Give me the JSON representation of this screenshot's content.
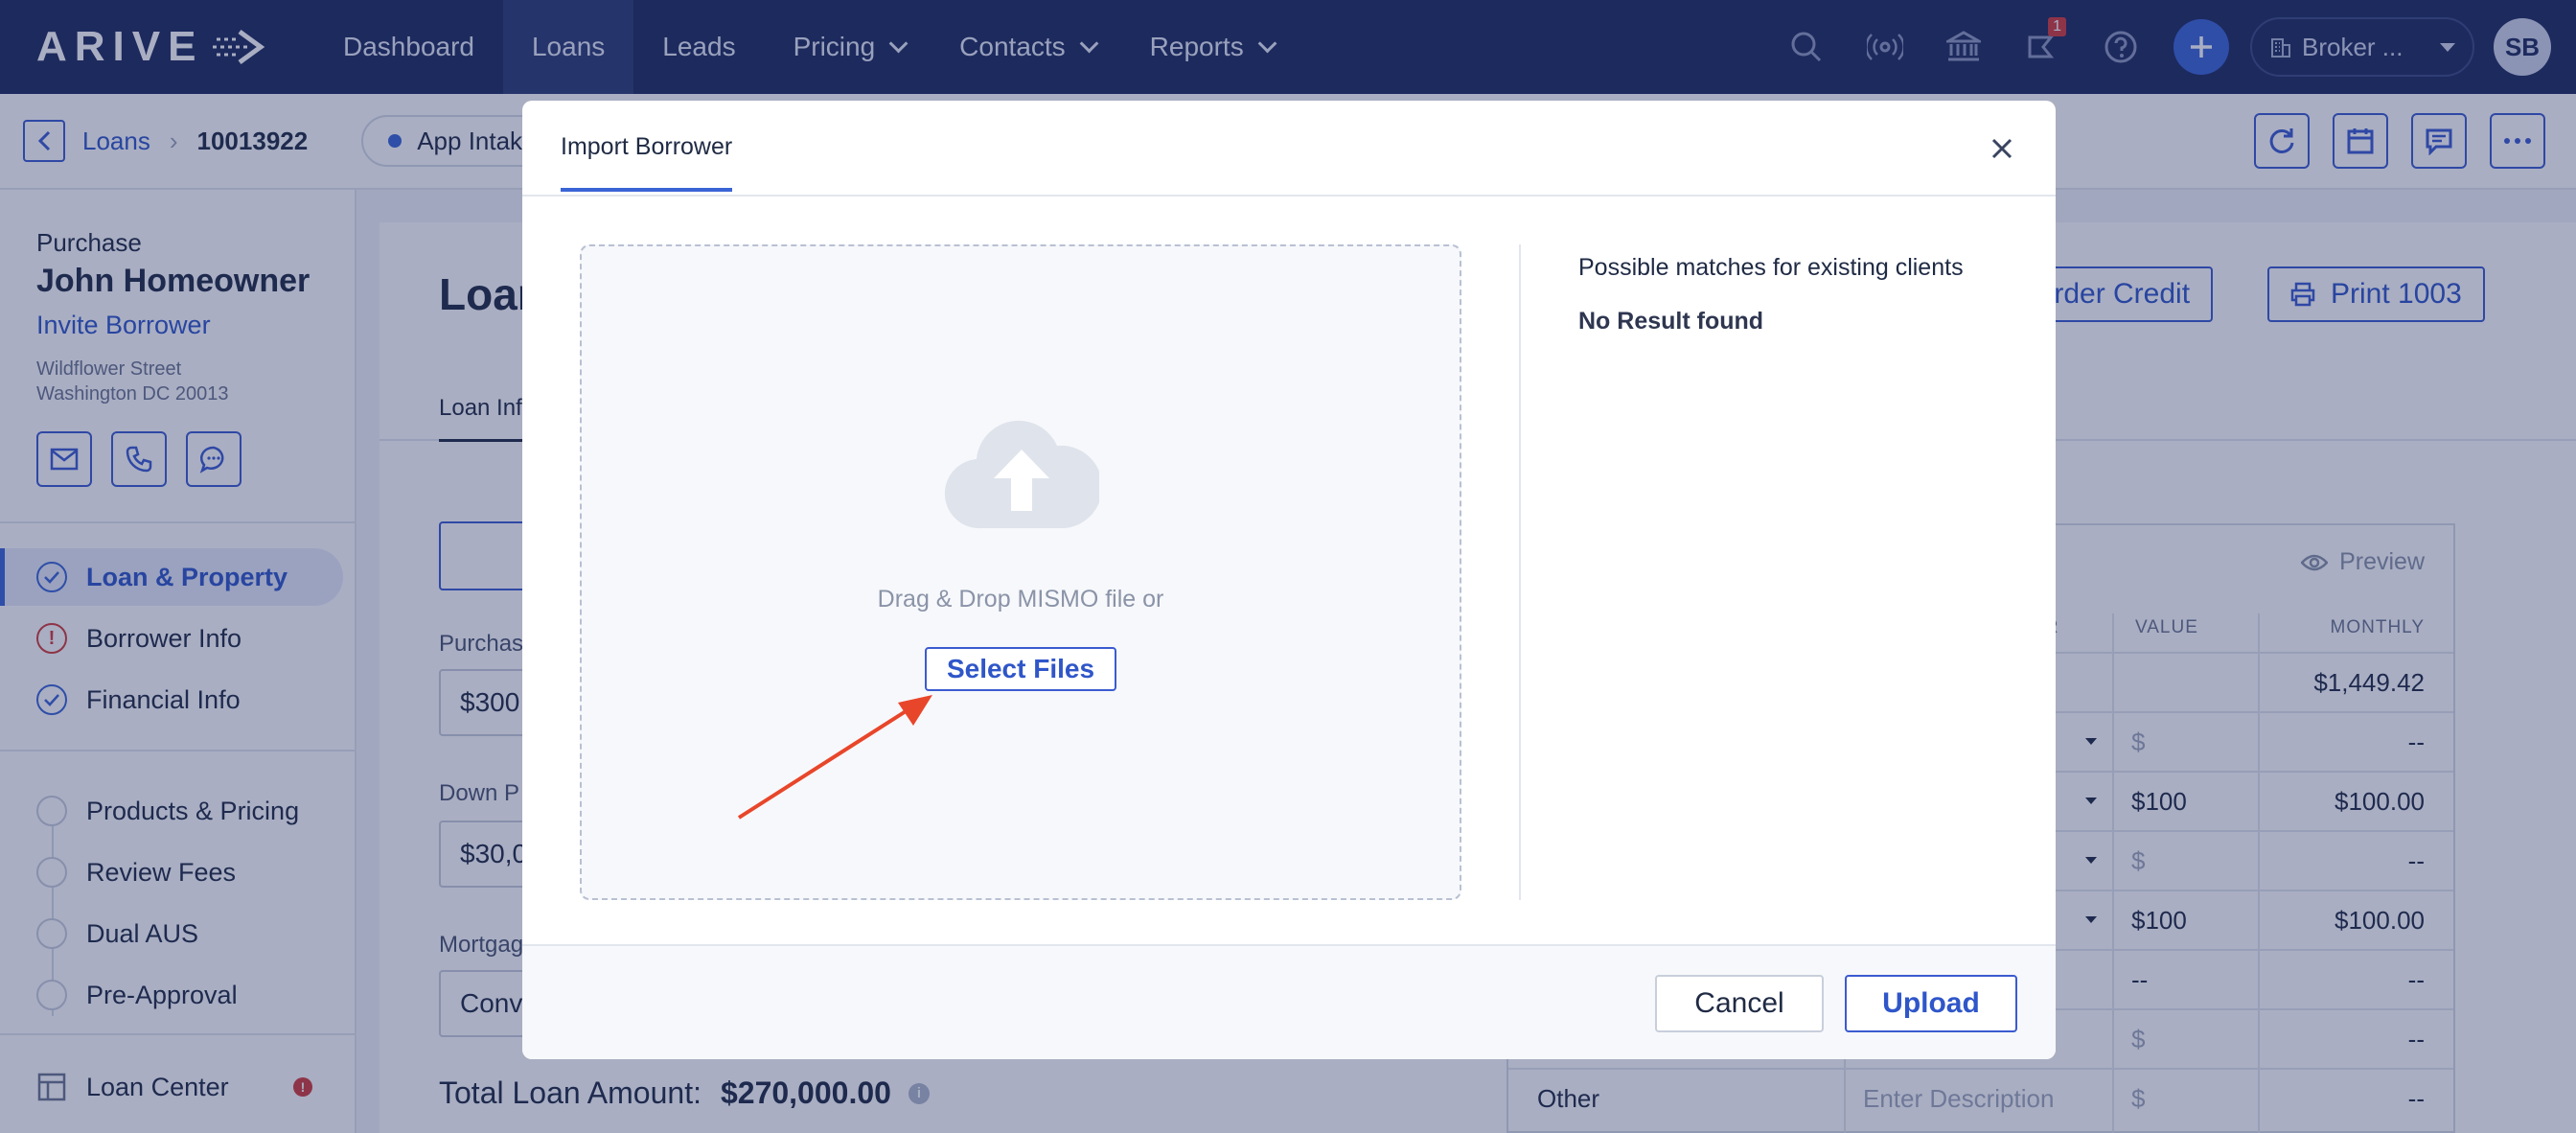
{
  "app": {
    "logo_text": "ARIVE"
  },
  "nav": {
    "items": [
      {
        "label": "Dashboard",
        "has_menu": false
      },
      {
        "label": "Loans",
        "has_menu": false,
        "active": true
      },
      {
        "label": "Leads",
        "has_menu": false
      },
      {
        "label": "Pricing",
        "has_menu": true
      },
      {
        "label": "Contacts",
        "has_menu": true
      },
      {
        "label": "Reports",
        "has_menu": true
      }
    ],
    "notification_count": "1",
    "broker_label": "Broker ...",
    "avatar_initials": "SB",
    "icons": [
      "search-icon",
      "broadcast-icon",
      "bank-icon",
      "announcement-icon",
      "help-icon",
      "plus-icon"
    ]
  },
  "breadcrumb": {
    "parent": "Loans",
    "loan_id": "10013922",
    "status": "App Intak",
    "status_color": "#3a64d6"
  },
  "sidebar": {
    "loan_type": "Purchase",
    "borrower_name": "John Homeowner",
    "invite_label": "Invite Borrower",
    "address_line1": "Wildflower Street",
    "address_line2": "Washington DC 20013",
    "steps_group1": [
      {
        "label": "Loan & Property",
        "state": "done",
        "active": true
      },
      {
        "label": "Borrower Info",
        "state": "warning"
      },
      {
        "label": "Financial Info",
        "state": "done"
      }
    ],
    "steps_group2": [
      {
        "label": "Products & Pricing",
        "state": "empty"
      },
      {
        "label": "Review Fees",
        "state": "empty"
      },
      {
        "label": "Dual AUS",
        "state": "empty"
      },
      {
        "label": "Pre-Approval",
        "state": "empty"
      }
    ],
    "loan_center_label": "Loan Center"
  },
  "main": {
    "title": "Loan",
    "order_credit_label": "Order Credit",
    "print_label": "Print 1003",
    "tab_label": "Loan Inf",
    "fields": [
      {
        "label": "Purchas",
        "value": "$300"
      },
      {
        "label": "Down P",
        "value": "$30,0"
      },
      {
        "label": "Mortgag",
        "value": "Conv"
      }
    ],
    "total_label": "Total Loan Amount:",
    "total_value": "$270,000.00"
  },
  "fees": {
    "preview_label": "Preview",
    "headers": {
      "factor": "OR",
      "value": "VALUE",
      "monthly": "MONTHLY"
    },
    "rows": [
      {
        "name": "",
        "factor": "",
        "value": "",
        "monthly": "$1,449.42"
      },
      {
        "name": "",
        "factor": ".",
        "value": "$",
        "monthly": "--"
      },
      {
        "name": "",
        "factor": ".",
        "value": "$100",
        "monthly": "$100.00"
      },
      {
        "name": "",
        "factor": ".",
        "value": "$",
        "monthly": "--"
      },
      {
        "name": "",
        "factor": ".",
        "value": "$100",
        "monthly": "$100.00"
      },
      {
        "name": "",
        "factor": "",
        "value": "--",
        "monthly": "--"
      },
      {
        "name": "",
        "factor": "",
        "value": "$",
        "monthly": "--"
      },
      {
        "name": "Other",
        "factor": "Enter Description",
        "value": "$",
        "monthly": "--"
      }
    ]
  },
  "modal": {
    "tab_label": "Import Borrower",
    "dropzone_text": "Drag & Drop MISMO file or",
    "select_files_label": "Select Files",
    "matches_title": "Possible matches for existing clients",
    "no_result": "No Result found",
    "cancel_label": "Cancel",
    "upload_label": "Upload",
    "annotation_color": "#e8462a"
  }
}
